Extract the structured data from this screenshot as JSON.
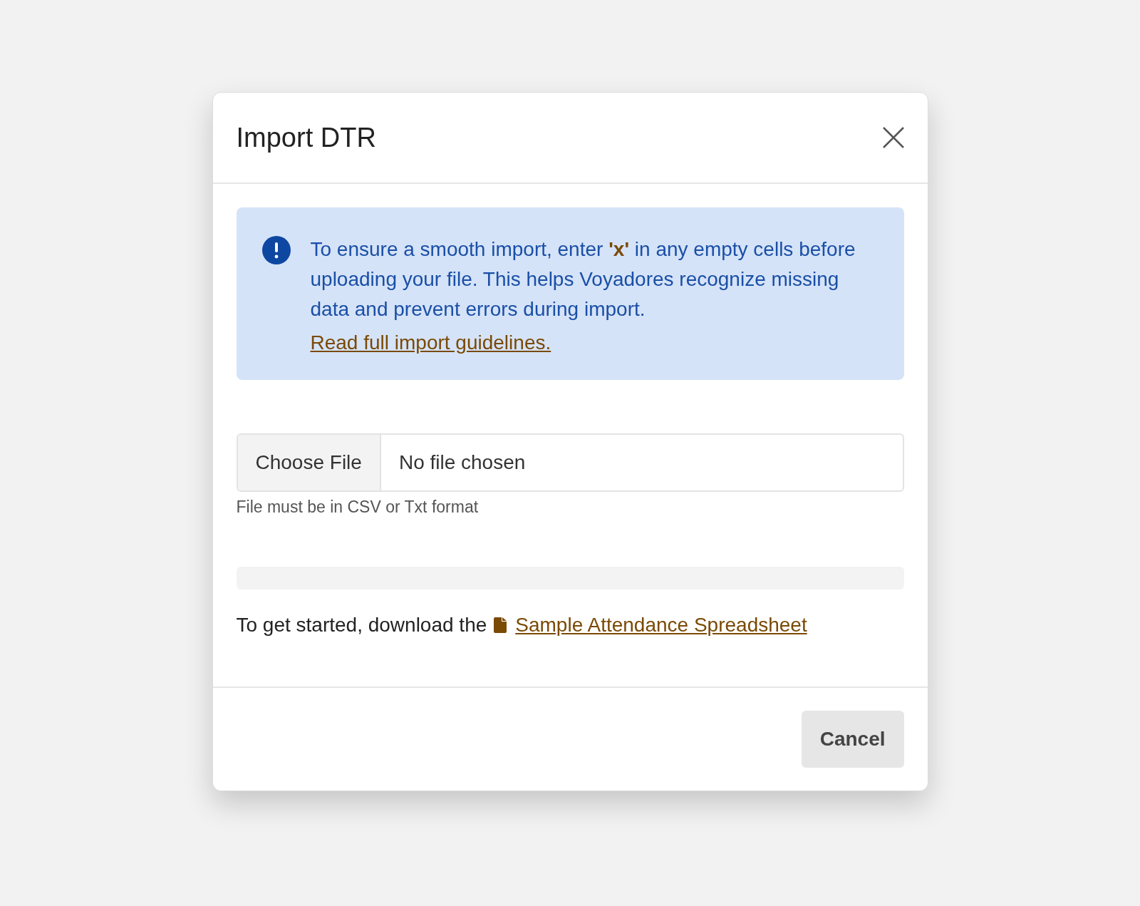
{
  "dialog": {
    "title": "Import DTR"
  },
  "alert": {
    "message": "To ensure a smooth import, enter **'x'** in any empty cells before uploading your file. This helps Voyadores recognize missing data and prevent errors during import.",
    "link": "Read full import guidelines."
  },
  "file_input": {
    "button": "Choose File",
    "value": "No file chosen",
    "hint": "File must be in CSV or Txt format"
  },
  "upload_progress": {
    "level": 0
  },
  "download": {
    "text": "To get started, download the",
    "link": "Sample Attendance Spreadsheet"
  },
  "buttons": [
    "Cancel"
  ]
}
